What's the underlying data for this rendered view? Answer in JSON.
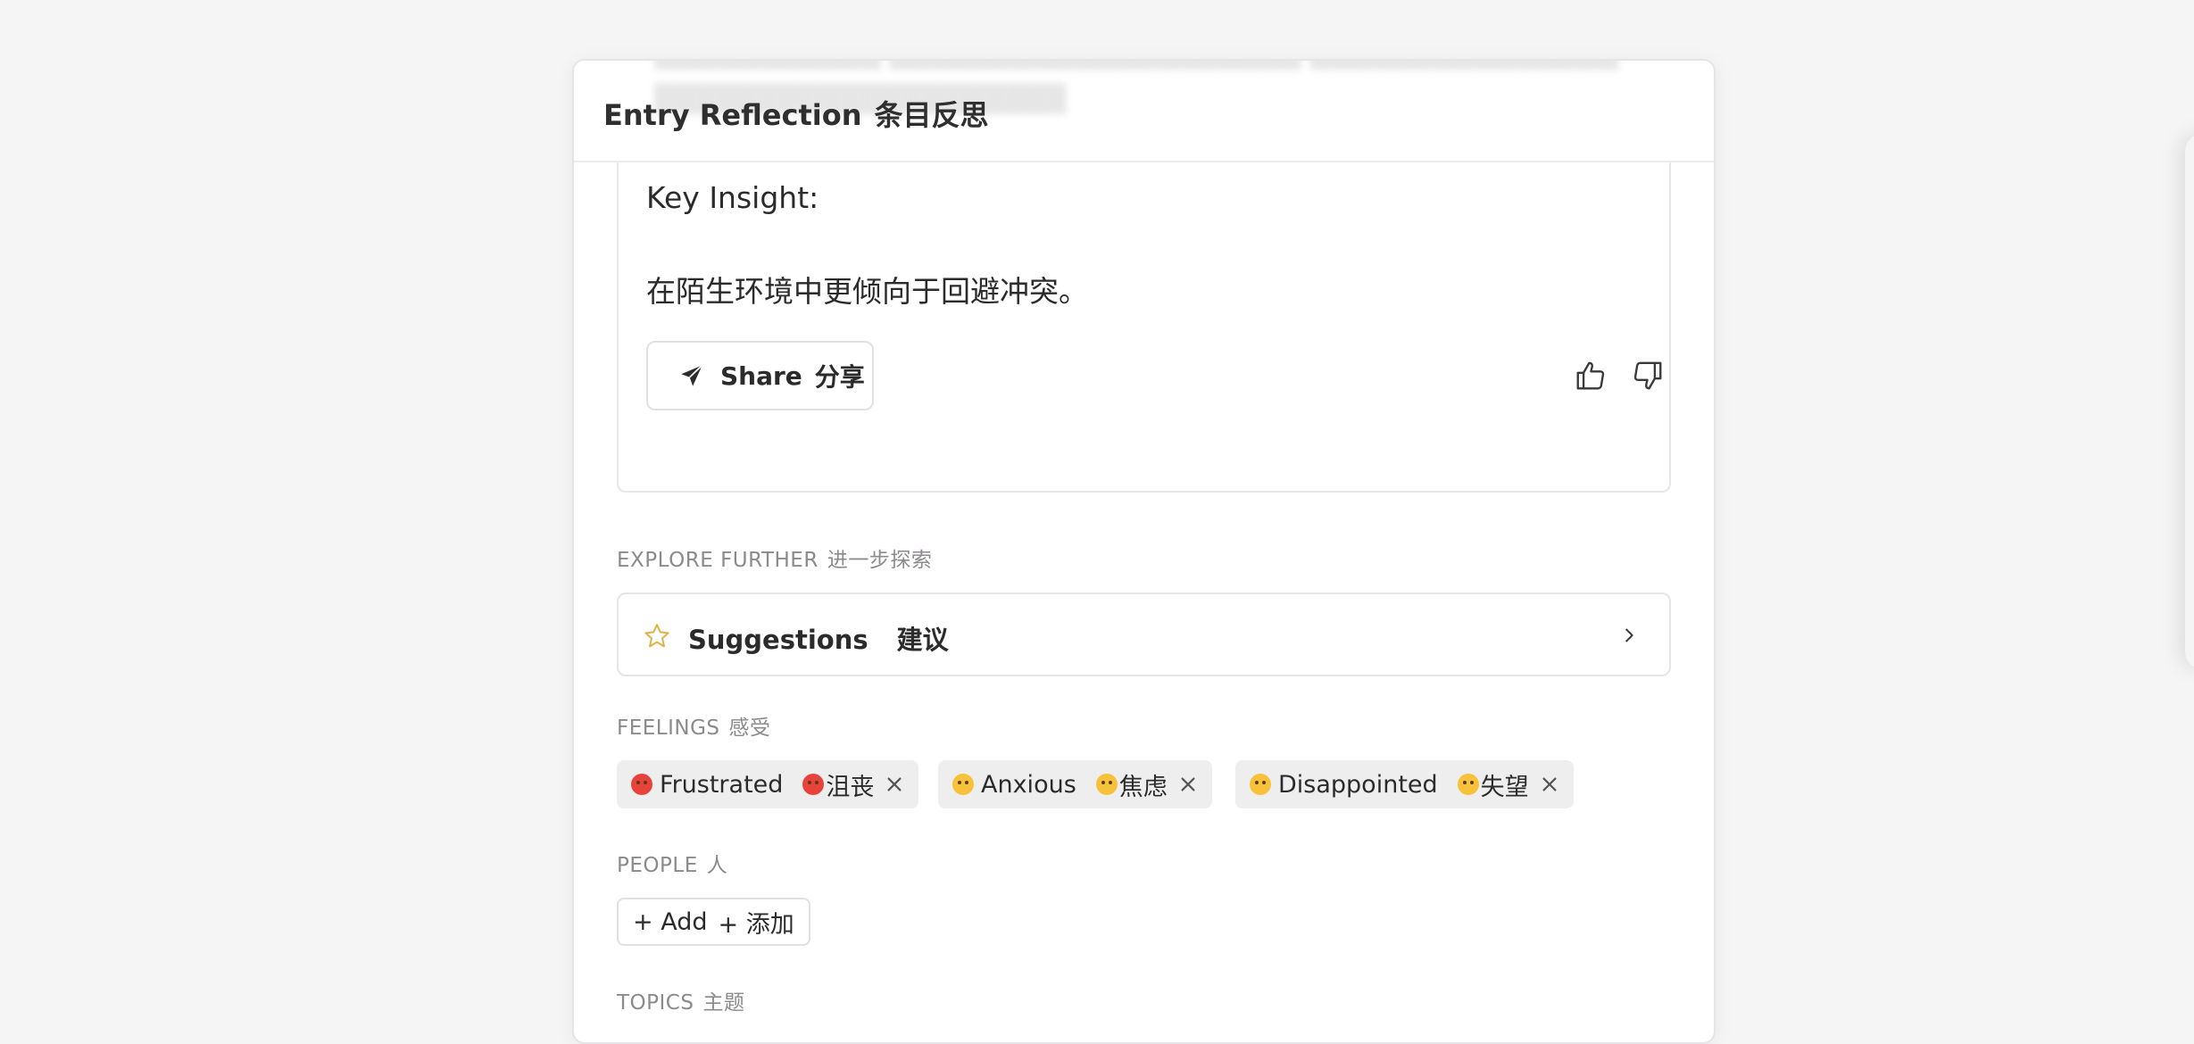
{
  "header": {
    "title": "Entry Reflection",
    "title_zh": "条目反思"
  },
  "insight": {
    "label": "Key Insight:",
    "text": "在陌生环境中更倾向于回避冲突。",
    "share_label": "Share",
    "share_label_zh": "分享"
  },
  "explore": {
    "section_label": "EXPLORE FURTHER",
    "section_label_zh": "进一步探索",
    "suggestions_label": "Suggestions",
    "suggestions_label_zh": "建议"
  },
  "feelings": {
    "section_label": "FEELINGS",
    "section_label_zh": "感受",
    "chips": [
      {
        "label": "Frustrated",
        "label_zh": "沮丧",
        "emoji": "angry-face-icon"
      },
      {
        "label": "Anxious",
        "label_zh": "焦虑",
        "emoji": "worried-face-icon"
      },
      {
        "label": "Disappointed",
        "label_zh": "失望",
        "emoji": "disappointed-face-icon"
      }
    ]
  },
  "people": {
    "section_label": "PEOPLE",
    "section_label_zh": "人",
    "add_label": "+ Add",
    "add_label_zh": "+ 添加"
  },
  "topics": {
    "section_label": "TOPICS",
    "section_label_zh": "主题"
  },
  "colors": {
    "background": "#f6f5f6",
    "card": "#ffffff",
    "chip": "#efeeef",
    "star": "#d9b44a"
  }
}
